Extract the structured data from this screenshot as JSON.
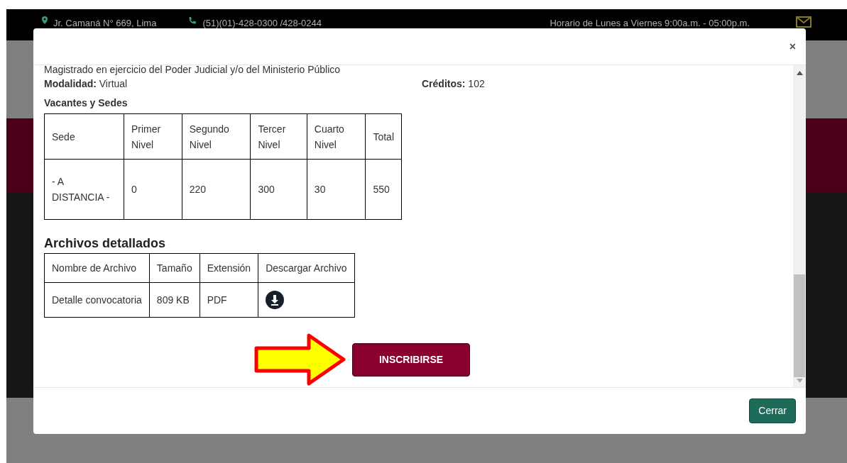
{
  "top_bar": {
    "address": "Jr. Camaná N° 669, Lima",
    "phone": "(51)(01)-428-0300 /428-0244",
    "hours": "Horario de Lunes a Viernes 9:00a.m. - 05:00p.m."
  },
  "modal": {
    "close": "×",
    "intro": "Magistrado en ejercicio del Poder Judicial y/o del Ministerio Público",
    "modality": {
      "label": "Modalidad:",
      "value": "Virtual"
    },
    "credits": {
      "label": "Créditos:",
      "value": "102"
    },
    "vacancies_title": "Vacantes y Sedes",
    "vacancies": {
      "columns": [
        "Sede",
        "Primer Nivel",
        "Segundo Nivel",
        "Tercer Nivel",
        "Cuarto Nivel",
        "Total"
      ],
      "rows": [
        [
          "- A DISTANCIA -",
          "0",
          "220",
          "300",
          "30",
          "550"
        ]
      ]
    },
    "files_title": "Archivos detallados",
    "files": {
      "columns": [
        "Nombre de Archivo",
        "Tamaño",
        "Extensión",
        "Descargar Archivo"
      ],
      "rows": [
        {
          "name": "Detalle convocatoria",
          "size": "809 KB",
          "extension": "PDF"
        }
      ]
    },
    "enroll_button": "INSCRIBIRSE",
    "close_button": "Cerrar"
  }
}
